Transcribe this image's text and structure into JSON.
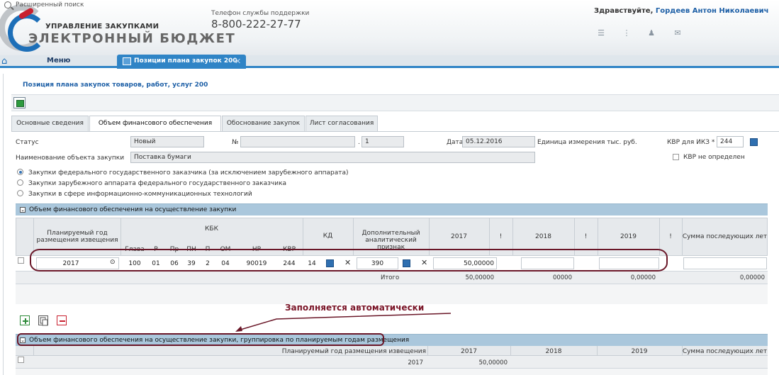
{
  "header": {
    "logo_top": "УПРАВЛЕНИЕ ЗАКУПКАМИ",
    "logo_main": "ЭЛЕКТРОННЫЙ БЮДЖЕТ",
    "support_label": "Телефон службы поддержки",
    "support_phone": "8-800-222-27-77",
    "search_placeholder": "Расширенный поиск",
    "greeting": "Здравствуйте,",
    "user_name": "Гордеев Антон Николаевич"
  },
  "menu": {
    "label": "Меню"
  },
  "open_tab": {
    "label": "Позиции плана закупок 200"
  },
  "page_title": "Позиция плана закупок товаров, работ, услуг 200",
  "tabs": [
    {
      "label": "Основные сведения"
    },
    {
      "label": "Объем финансового обеспечения"
    },
    {
      "label": "Обоснование закупок"
    },
    {
      "label": "Лист согласования"
    }
  ],
  "form": {
    "status_label": "Статус",
    "status_value": "Новый",
    "number_label": "№",
    "number_suffix": "1",
    "date_label": "Дата",
    "date_value": "05.12.2016",
    "unit_label": "Единица измерения тыс. руб.",
    "kvr_ikz_label": "КВР для ИКЗ *",
    "kvr_ikz_value": "244",
    "kvr_undefined_label": "КВР не определен",
    "object_label": "Наименование объекта закупки",
    "object_value": "Поставка бумаги"
  },
  "radios": [
    {
      "label": "Закупки федерального государственного заказчика (за исключением зарубежного аппарата)",
      "checked": true
    },
    {
      "label": "Закупки зарубежного аппарата федерального государственного заказчика",
      "checked": false
    },
    {
      "label": "Закупки в сфере информационно-коммуникационных технологий",
      "checked": false
    }
  ],
  "section1": {
    "title": "Объем финансового обеспечения на осуществление закупки"
  },
  "grid1": {
    "col_plan_year": "Планируемый год размещения извещения",
    "col_kbk": "КБК",
    "kbk_sub": [
      "Глава",
      "Р",
      "Пр",
      "ПН",
      "П",
      "ОМ",
      "НР",
      "КВР"
    ],
    "col_kd": "КД",
    "col_extra": "Дополнительный аналитический признак",
    "col_2017": "2017",
    "col_2018": "2018",
    "col_2019": "2019",
    "col_excl": "!",
    "col_later": "Сумма последующих лет",
    "row": {
      "plan_year": "2017",
      "kbk": [
        "100",
        "01",
        "06",
        "39",
        "2",
        "04",
        "90019",
        "244"
      ],
      "kd": "14",
      "extra": "390",
      "v2017": "50,00000"
    },
    "total": {
      "label": "Итого",
      "v2017": "50,00000",
      "v2018": "00000",
      "v2019": "0,00000",
      "later": "0,00000"
    }
  },
  "annotation": "Заполняется автоматически",
  "section2": {
    "title": "Объем финансового обеспечения на осуществление закупки, группировка по планируемым годам размещения"
  },
  "grid2": {
    "col_plan_year": "Планируемый год размещения извещения",
    "col_2017": "2017",
    "col_2018": "2018",
    "col_2019": "2019",
    "col_later": "Сумма последующих лет",
    "row": {
      "plan_year": "2017",
      "v2017": "50,00000"
    }
  }
}
